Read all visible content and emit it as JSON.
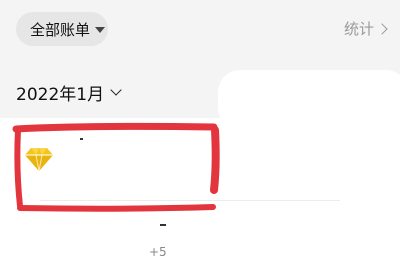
{
  "header": {
    "account_filter_label": "全部账单",
    "stats_link_label": "统计"
  },
  "month_picker": {
    "label": "2022年1月"
  },
  "list": {
    "items": [
      {
        "icon": "diamond-icon",
        "icon_color": "#F5C518"
      }
    ],
    "footer_value": "+5"
  },
  "colors": {
    "header_bg": "#f4f4f4",
    "annotation_red": "#e0202a"
  }
}
